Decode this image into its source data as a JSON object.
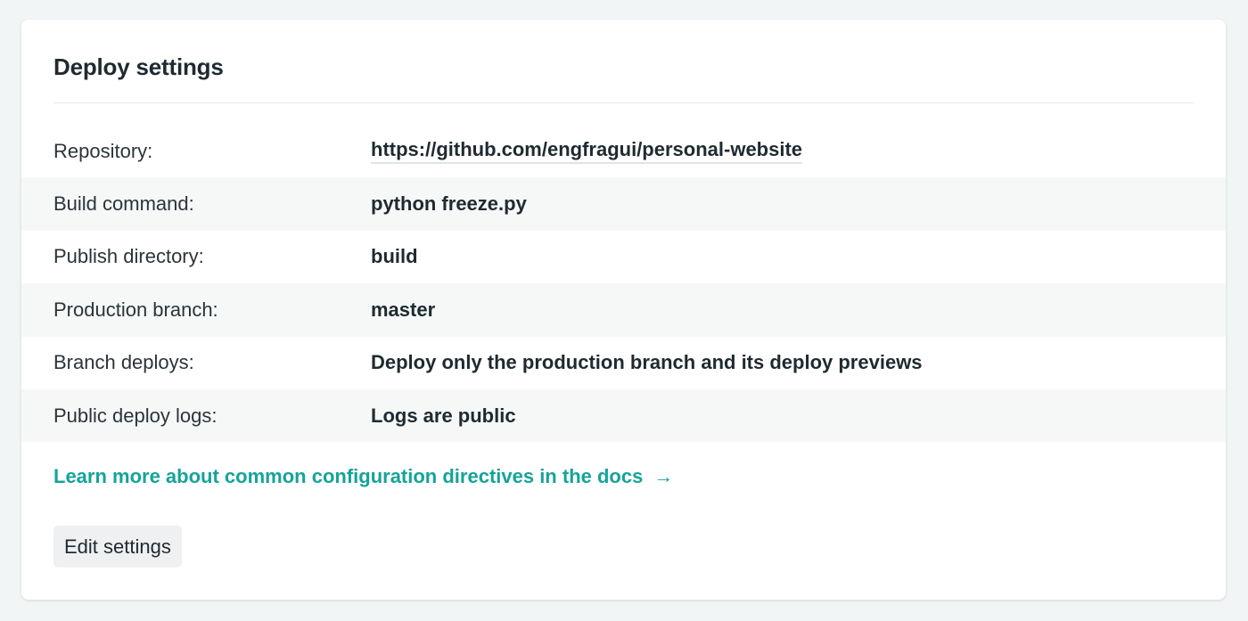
{
  "card": {
    "title": "Deploy settings"
  },
  "settings": [
    {
      "label": "Repository:",
      "value": "https://github.com/engfragui/personal-website",
      "is_link": true
    },
    {
      "label": "Build command:",
      "value": "python freeze.py",
      "is_link": false
    },
    {
      "label": "Publish directory:",
      "value": "build",
      "is_link": false
    },
    {
      "label": "Production branch:",
      "value": "master",
      "is_link": false
    },
    {
      "label": "Branch deploys:",
      "value": "Deploy only the production branch and its deploy previews",
      "is_link": false
    },
    {
      "label": "Public deploy logs:",
      "value": "Logs are public",
      "is_link": false
    }
  ],
  "docs_link": {
    "label": "Learn more about common configuration directives in the docs",
    "icon": "arrow-right-icon",
    "glyph": "→",
    "color": "#15a399"
  },
  "actions": {
    "edit_label": "Edit settings"
  }
}
